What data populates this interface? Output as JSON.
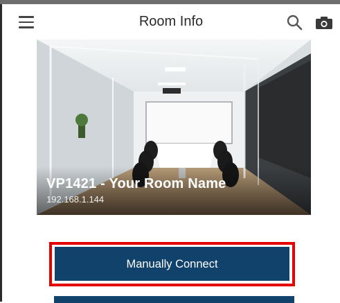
{
  "header": {
    "title": "Room Info",
    "menu_icon": "hamburger-menu-icon",
    "search_icon": "search-icon",
    "camera_icon": "camera-icon"
  },
  "room": {
    "name": "VP1421 - Your Room Name",
    "ip": "192.168.1.144"
  },
  "actions": {
    "manual_connect_label": "Manually Connect"
  },
  "colors": {
    "button_bg": "#10426c",
    "highlight": "#e30000"
  }
}
